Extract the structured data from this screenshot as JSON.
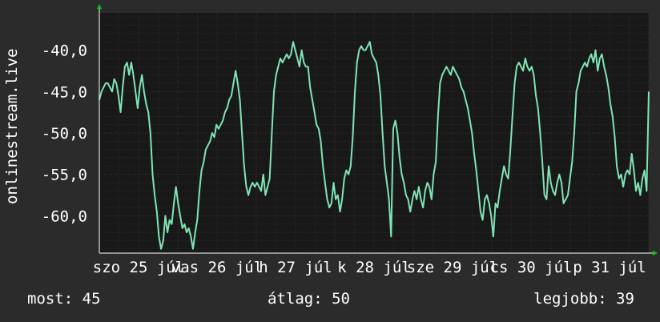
{
  "chart_data": {
    "type": "line",
    "ylabel": "onlinestream.live",
    "ylim": [
      -64.5,
      -35.5
    ],
    "y_ticks": [
      -40,
      -45,
      -50,
      -55,
      -60
    ],
    "y_tick_labels": [
      "-40,0",
      "-45,0",
      "-50,0",
      "-55,0",
      "-60,0"
    ],
    "x_tick_labels": [
      "szo 25 júl",
      "vas 26 júl",
      "h 27 júl",
      "k 28 júl",
      "sze 29 júl",
      "cs 30 júl",
      "p 31 júl"
    ],
    "grid": true,
    "colors": {
      "background": "#2b2b2b",
      "plot": "#181818",
      "grid": "#3a3a3a",
      "line": "#7fe5b4",
      "axis": "#ffffff",
      "arrow": "#00cc00"
    },
    "x_range_days": 7,
    "series": [
      {
        "values": [
          -46.0,
          -45.0,
          -44.5,
          -44.0,
          -44.0,
          -44.5,
          -45.0,
          -43.5,
          -44.0,
          -45.5,
          -47.5,
          -44.5,
          -42.0,
          -41.5,
          -43.0,
          -41.5,
          -43.0,
          -45.0,
          -47.0,
          -44.5,
          -43.0,
          -45.0,
          -46.5,
          -47.5,
          -50.0,
          -55.0,
          -57.5,
          -59.5,
          -62.5,
          -64.0,
          -63.0,
          -60.0,
          -62.0,
          -60.5,
          -61.0,
          -58.5,
          -56.5,
          -58.5,
          -60.0,
          -61.5,
          -61.0,
          -62.0,
          -61.5,
          -62.5,
          -64.0,
          -62.0,
          -60.5,
          -57.0,
          -54.5,
          -53.5,
          -52.0,
          -51.5,
          -51.0,
          -50.0,
          -50.5,
          -49.0,
          -49.5,
          -49.0,
          -48.5,
          -47.5,
          -47.0,
          -46.0,
          -45.5,
          -44.0,
          -42.5,
          -44.0,
          -46.0,
          -50.0,
          -54.0,
          -56.5,
          -57.5,
          -56.5,
          -56.0,
          -56.5,
          -56.0,
          -56.5,
          -57.0,
          -55.0,
          -57.5,
          -56.5,
          -55.5,
          -50.0,
          -45.0,
          -43.0,
          -42.0,
          -41.0,
          -41.5,
          -41.0,
          -40.5,
          -41.0,
          -40.5,
          -39.0,
          -40.0,
          -41.0,
          -42.0,
          -40.0,
          -41.5,
          -42.0,
          -42.0,
          -44.5,
          -46.0,
          -47.5,
          -49.0,
          -49.5,
          -51.0,
          -54.0,
          -56.0,
          -58.0,
          -59.0,
          -58.5,
          -56.0,
          -58.0,
          -57.5,
          -59.5,
          -58.0,
          -55.5,
          -54.5,
          -55.0,
          -54.0,
          -50.5,
          -45.0,
          -41.5,
          -40.0,
          -39.5,
          -40.0,
          -40.0,
          -39.5,
          -39.0,
          -40.5,
          -41.0,
          -41.5,
          -43.0,
          -45.5,
          -50.0,
          -54.0,
          -56.0,
          -58.0,
          -62.5,
          -49.5,
          -48.5,
          -50.0,
          -53.0,
          -55.0,
          -56.0,
          -57.5,
          -58.0,
          -59.5,
          -58.0,
          -57.0,
          -58.0,
          -56.5,
          -58.0,
          -59.0,
          -57.0,
          -56.0,
          -56.5,
          -58.0,
          -55.0,
          -53.5,
          -48.0,
          -44.0,
          -43.0,
          -42.5,
          -42.0,
          -42.5,
          -43.0,
          -42.0,
          -42.5,
          -43.0,
          -43.5,
          -44.5,
          -45.0,
          -46.0,
          -47.0,
          -48.5,
          -50.0,
          -52.5,
          -54.5,
          -57.0,
          -59.5,
          -60.5,
          -58.0,
          -57.5,
          -58.5,
          -60.0,
          -62.5,
          -58.5,
          -59.0,
          -57.0,
          -55.5,
          -54.0,
          -55.0,
          -55.5,
          -52.0,
          -48.0,
          -44.0,
          -42.0,
          -41.5,
          -42.0,
          -42.5,
          -41.0,
          -42.0,
          -42.5,
          -42.0,
          -43.0,
          -45.5,
          -47.0,
          -50.0,
          -53.5,
          -57.5,
          -58.0,
          -54.0,
          -56.0,
          -57.0,
          -57.5,
          -56.0,
          -55.0,
          -56.0,
          -58.5,
          -58.0,
          -57.5,
          -55.5,
          -53.5,
          -50.0,
          -45.0,
          -44.0,
          -42.5,
          -42.0,
          -41.5,
          -42.0,
          -41.0,
          -40.5,
          -41.5,
          -40.0,
          -42.5,
          -41.0,
          -40.5,
          -42.0,
          -43.0,
          -44.5,
          -46.5,
          -48.0,
          -50.5,
          -54.0,
          -55.5,
          -55.0,
          -56.5,
          -55.0,
          -54.5,
          -55.0,
          -52.5,
          -54.5,
          -57.0,
          -56.0,
          -57.5,
          -55.5,
          -54.5,
          -57.0,
          -45.0
        ]
      }
    ]
  },
  "footer": {
    "now": "most: 45",
    "avg": "átlag: 50",
    "best": "legjobb: 39"
  }
}
